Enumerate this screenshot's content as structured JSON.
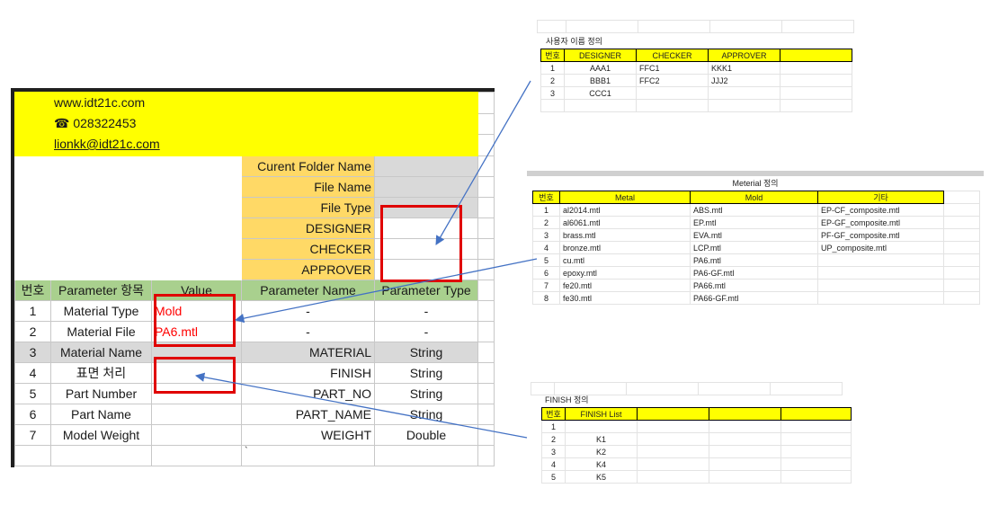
{
  "main": {
    "contact": {
      "website": "www.idt21c.com",
      "phone_icon": "☎",
      "phone": "028322453",
      "email": "lionkk@idt21c.com"
    },
    "file_info": [
      {
        "label": "Curent Folder Name",
        "value": ""
      },
      {
        "label": "File Name",
        "value": ""
      },
      {
        "label": "File Type",
        "value": ""
      },
      {
        "label": "DESIGNER",
        "value": ""
      },
      {
        "label": "CHECKER",
        "value": ""
      },
      {
        "label": "APPROVER",
        "value": ""
      }
    ],
    "table_headers": [
      "번호",
      "Parameter 항목",
      "Value",
      "Parameter Name",
      "Parameter Type"
    ],
    "rows": [
      {
        "no": "1",
        "item": "Material Type",
        "value": "Mold",
        "param_name": "-",
        "param_type": "-"
      },
      {
        "no": "2",
        "item": "Material File",
        "value": "PA6.mtl",
        "param_name": "-",
        "param_type": "-"
      },
      {
        "no": "3",
        "item": "Material Name",
        "value": "",
        "param_name": "MATERIAL",
        "param_type": "String"
      },
      {
        "no": "4",
        "item": "표면 처리",
        "value": "",
        "param_name": "FINISH",
        "param_type": "String"
      },
      {
        "no": "5",
        "item": "Part Number",
        "value": "",
        "param_name": "PART_NO",
        "param_type": "String"
      },
      {
        "no": "6",
        "item": "Part Name",
        "value": "",
        "param_name": "PART_NAME",
        "param_type": "String"
      },
      {
        "no": "7",
        "item": "Model Weight",
        "value": "",
        "param_name": "WEIGHT",
        "param_type": "Double"
      }
    ],
    "footer_mark": "`"
  },
  "user_sheet": {
    "caption": "사용자 이름 정의",
    "headers": [
      "번호",
      "DESIGNER",
      "CHECKER",
      "APPROVER"
    ],
    "rows": [
      {
        "no": "1",
        "designer": "AAA1",
        "checker": "FFC1",
        "approver": "KKK1"
      },
      {
        "no": "2",
        "designer": "BBB1",
        "checker": "FFC2",
        "approver": "JJJ2"
      },
      {
        "no": "3",
        "designer": "CCC1",
        "checker": "",
        "approver": ""
      }
    ]
  },
  "material_sheet": {
    "caption": "Meterial 정의",
    "headers": [
      "번호",
      "Metal",
      "Mold",
      "기타"
    ],
    "rows": [
      {
        "no": "1",
        "metal": "al2014.mtl",
        "mold": "ABS.mtl",
        "other": "EP-CF_composite.mtl"
      },
      {
        "no": "2",
        "metal": "al6061.mtl",
        "mold": "EP.mtl",
        "other": "EP-GF_composite.mtl"
      },
      {
        "no": "3",
        "metal": "brass.mtl",
        "mold": "EVA.mtl",
        "other": "PF-GF_composite.mtl"
      },
      {
        "no": "4",
        "metal": "bronze.mtl",
        "mold": "LCP.mtl",
        "other": "UP_composite.mtl"
      },
      {
        "no": "5",
        "metal": "cu.mtl",
        "mold": "PA6.mtl",
        "other": ""
      },
      {
        "no": "6",
        "metal": "epoxy.mtl",
        "mold": "PA6-GF.mtl",
        "other": ""
      },
      {
        "no": "7",
        "metal": "fe20.mtl",
        "mold": "PA66.mtl",
        "other": ""
      },
      {
        "no": "8",
        "metal": "fe30.mtl",
        "mold": "PA66-GF.mtl",
        "other": ""
      }
    ]
  },
  "finish_sheet": {
    "caption": "FINISH 정의",
    "headers": [
      "번호",
      "FINISH List"
    ],
    "rows": [
      {
        "no": "1",
        "item": ""
      },
      {
        "no": "2",
        "item": "K1"
      },
      {
        "no": "3",
        "item": "K2"
      },
      {
        "no": "4",
        "item": "K4"
      },
      {
        "no": "5",
        "item": "K5"
      }
    ]
  },
  "colors": {
    "highlight_yellow": "#ffff00",
    "label_orange": "#ffd966",
    "header_green": "#a9d08e",
    "readonly_gray": "#d9d9d9",
    "annotation_red": "#e00000",
    "arrow_blue": "#4472c4"
  }
}
